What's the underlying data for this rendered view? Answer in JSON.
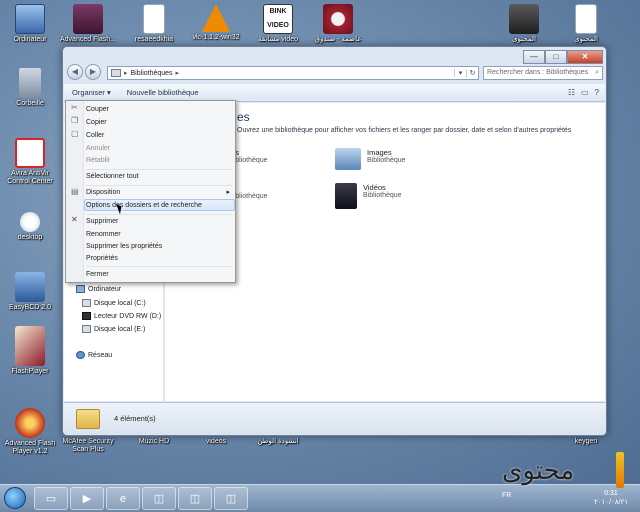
{
  "desktop": {
    "icons": [
      {
        "label": "Ordinateur",
        "color": "#4f7fc0"
      },
      {
        "label": "Advanced Flash...",
        "color": "#6b2a5a"
      },
      {
        "label": "resaeedkhia",
        "color": "#ffffff"
      },
      {
        "label": "vlc-1.1.2-win32",
        "color": "#f08a00"
      },
      {
        "label": "مسابقة video",
        "color": "#222222"
      },
      {
        "label": "عاصمة - صندوق",
        "color": "#a02030"
      },
      {
        "label": "المحتوى",
        "color": "#2a2a2a"
      },
      {
        "label": "المحتوى",
        "color": "#ffffff"
      },
      {
        "label": "Corbeille",
        "color": "#6c7f94"
      },
      {
        "label": "Avira AntiVir Control Center",
        "color": "#d8232a"
      },
      {
        "label": "desktop",
        "color": "#e8e8e8"
      },
      {
        "label": "EasyBCD 2.0",
        "color": "#3a6fb0"
      },
      {
        "label": "FlashPlayer",
        "color": "#8b1a2a"
      },
      {
        "label": "Advanced Flash Player v1.2",
        "color": "#c0301a"
      },
      {
        "label": "McAfee Security Scan Plus",
        "color": "#b01020"
      },
      {
        "label": "Muzic HD",
        "color": "#3a5a8a"
      },
      {
        "label": "videos",
        "color": "#3a5a8a"
      },
      {
        "label": "انشودة الوطن",
        "color": "#3a5a8a"
      },
      {
        "label": "keygen",
        "color": "#3a5a8a"
      }
    ]
  },
  "explorer": {
    "caption": {
      "minimize": "—",
      "maximize": "□",
      "close": "✕"
    },
    "nav": {
      "back": "◀",
      "forward": "▶"
    },
    "address": {
      "path": "Bibliothèques",
      "sep": "▸",
      "dropdown": "▾",
      "refresh": "↻"
    },
    "search": {
      "placeholder": "Rechercher dans : Bibliothèques",
      "icon": "⌕"
    },
    "toolbar": {
      "organize": "Organiser ▾",
      "new_library": "Nouvelle bibliothèque",
      "view_icon": "☷",
      "preview_icon": "▭",
      "help_icon": "?"
    },
    "main": {
      "header": "Bibliothèques",
      "header_partial": "es",
      "subtitle": "Ouvrez une bibliothèque pour afficher vos fichiers et les ranger par dossier, date et selon d'autres propriétés",
      "libraries": [
        {
          "name": "Documents",
          "partial": "nts",
          "type": "Bibliothèque"
        },
        {
          "name": "Images",
          "type": "Bibliothèque"
        },
        {
          "name": "Musique",
          "partial": "",
          "type": "Bibliothèque"
        },
        {
          "name": "Vidéos",
          "type": "Bibliothèque"
        }
      ]
    },
    "tree": [
      {
        "label": "Ordinateur",
        "icon": "computer-icon"
      },
      {
        "label": "Disque local (C:)",
        "icon": "drive-icon"
      },
      {
        "label": "Lecteur DVD RW (D:)",
        "icon": "dvd-icon"
      },
      {
        "label": "Disque local (E:)",
        "icon": "drive-icon"
      },
      {
        "label": "Réseau",
        "icon": "network-icon"
      }
    ],
    "status": {
      "count": "4 élément(s)"
    }
  },
  "menu": {
    "items": [
      {
        "label": "Couper",
        "disabled": false
      },
      {
        "label": "Copier",
        "disabled": false
      },
      {
        "label": "Coller",
        "disabled": false
      },
      {
        "label": "Annuler",
        "disabled": true
      },
      {
        "label": "Rétablir",
        "disabled": true
      },
      {
        "label": "Sélectionner tout",
        "disabled": false
      },
      {
        "label": "Disposition",
        "disabled": false,
        "submenu": "▸"
      },
      {
        "label": "Options des dossiers et de recherche",
        "disabled": false,
        "hover": true
      },
      {
        "label": "Supprimer",
        "disabled": false
      },
      {
        "label": "Renommer",
        "disabled": false
      },
      {
        "label": "Supprimer les propriétés",
        "disabled": false
      },
      {
        "label": "Propriétés",
        "disabled": false
      },
      {
        "label": "Fermer",
        "disabled": false
      }
    ]
  },
  "taskbar": {
    "lang": "FR",
    "time": "0:31",
    "date": "٢٠١٠/٠٨/٢١"
  },
  "watermark": {
    "text": "محتوى"
  }
}
